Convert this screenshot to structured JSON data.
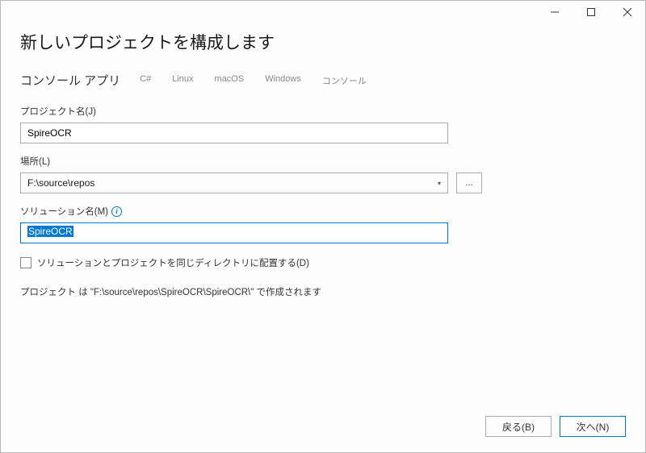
{
  "titlebar": {
    "minimize": "—",
    "maximize": "☐",
    "close": "✕"
  },
  "page_title": "新しいプロジェクトを構成します",
  "subtitle": "コンソール アプリ",
  "tags": [
    "C#",
    "Linux",
    "macOS",
    "Windows",
    "コンソール"
  ],
  "fields": {
    "project_name": {
      "label": "プロジェクト名(J)",
      "value": "SpireOCR"
    },
    "location": {
      "label": "場所(L)",
      "value": "F:\\source\\repos",
      "browse": "..."
    },
    "solution_name": {
      "label": "ソリューション名(M)",
      "value": "SpireOCR"
    },
    "same_dir_checkbox": "ソリューションとプロジェクトを同じディレクトリに配置する(D)"
  },
  "path_info": "プロジェクト は \"F:\\source\\repos\\SpireOCR\\SpireOCR\\\" で作成されます",
  "footer": {
    "back": "戻る(B)",
    "next": "次へ(N)"
  }
}
